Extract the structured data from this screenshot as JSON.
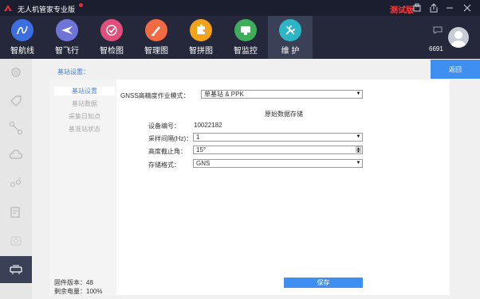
{
  "window": {
    "title": "无人机管家专业版",
    "test_label": "测试版"
  },
  "topnav": {
    "items": [
      {
        "label": "智航线",
        "color": "#3c6ee0",
        "icon": "route-icon"
      },
      {
        "label": "智飞行",
        "color": "#6e74d8",
        "icon": "airplane-icon"
      },
      {
        "label": "智检图",
        "color": "#e04f7a",
        "icon": "check-icon"
      },
      {
        "label": "智理图",
        "color": "#f26a42",
        "icon": "brush-icon"
      },
      {
        "label": "智拼图",
        "color": "#f3a21a",
        "icon": "puzzle-icon"
      },
      {
        "label": "智监控",
        "color": "#3fae5a",
        "icon": "monitor-icon"
      },
      {
        "label": "维 护",
        "color": "#2bb5c6",
        "icon": "wrench-icon"
      }
    ],
    "user_id": "6691"
  },
  "sidebar": {
    "icons": [
      "gimbal-icon",
      "tag-icon",
      "drone-icon",
      "cloud-icon",
      "link-icon",
      "edit-list-icon",
      "camera-icon",
      "base-station-icon"
    ]
  },
  "page": {
    "title": "基站设置：",
    "back_label": "返回"
  },
  "subnav": {
    "items": [
      "基站设置",
      "基站数据",
      "采集日知点",
      "基准站状态"
    ],
    "firmware": "固件版本：48",
    "battery": "剩余电量：100%"
  },
  "form": {
    "mode_label": "GNSS高精度作业模式：",
    "mode_value": "单基站 & PPK",
    "section_title": "原始数据存储",
    "device_label": "设备编号：",
    "device_value": "10022182",
    "interval_label": "采样间隔(Hz)：",
    "interval_value": "1",
    "elevation_label": "高度截止角：",
    "elevation_value": "15°",
    "format_label": "存储格式：",
    "format_value": "GNS",
    "save_label": "保存"
  },
  "colors": {
    "accent": "#3f8ff2",
    "nav_bg": "#24283a",
    "title_bg": "#1b1e2e",
    "test_red": "#ff3b3b"
  }
}
